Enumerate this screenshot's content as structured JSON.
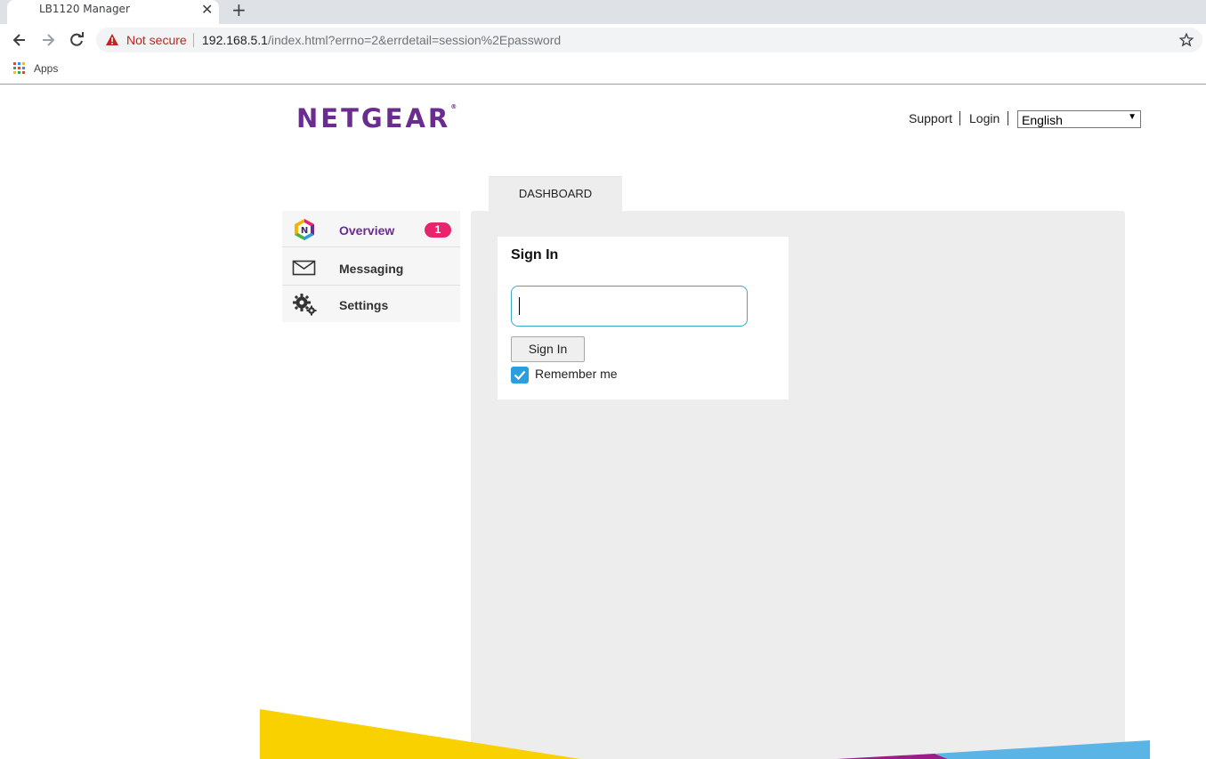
{
  "browser": {
    "tab_title": "LB1120 Manager",
    "close_glyph": "✕",
    "new_tab_glyph": "+",
    "security_label": "Not secure",
    "url_host": "192.168.5.1",
    "url_rest": "/index.html?errno=2&errdetail=session%2Epassword",
    "bookmark_apps": "Apps"
  },
  "header": {
    "logo": "NETGEAR",
    "logo_mark": "®",
    "links": {
      "support": "Support",
      "login": "Login"
    },
    "language": {
      "selected": "English",
      "arrow": "▼"
    }
  },
  "tabs": {
    "dashboard": "DASHBOARD"
  },
  "sidebar": {
    "items": [
      {
        "label": "Overview",
        "icon": "netgear-overview-icon",
        "badge": "1"
      },
      {
        "label": "Messaging",
        "icon": "envelope-icon"
      },
      {
        "label": "Settings",
        "icon": "gears-icon"
      }
    ]
  },
  "signin": {
    "title": "Sign In",
    "password_value": "",
    "button_label": "Sign In",
    "remember_label": "Remember me",
    "remember_checked": true
  },
  "colors": {
    "brand_purple": "#6b2c8f",
    "badge_pink": "#e8246f",
    "checkbox_blue": "#2a9ee0",
    "input_focus": "#3ba9c9",
    "deco_yellow": "#f9d000",
    "deco_magenta": "#9b1d8a",
    "deco_blue": "#5ab4e5"
  }
}
